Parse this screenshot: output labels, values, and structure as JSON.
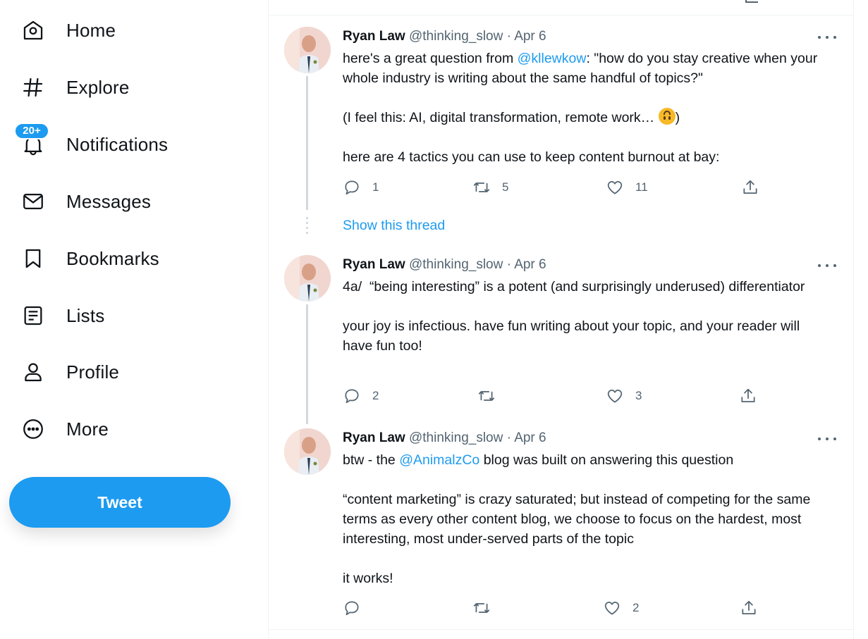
{
  "sidebar": {
    "items": [
      {
        "label": "Home",
        "icon": "home-icon"
      },
      {
        "label": "Explore",
        "icon": "hashtag-icon"
      },
      {
        "label": "Notifications",
        "icon": "bell-icon",
        "badge": "20+"
      },
      {
        "label": "Messages",
        "icon": "envelope-icon"
      },
      {
        "label": "Bookmarks",
        "icon": "bookmark-icon"
      },
      {
        "label": "Lists",
        "icon": "list-icon"
      },
      {
        "label": "Profile",
        "icon": "person-icon"
      },
      {
        "label": "More",
        "icon": "more-circle-icon"
      }
    ],
    "tweet_button": "Tweet"
  },
  "colors": {
    "accent": "#1d9bf0",
    "text": "#0f1419",
    "muted": "#536471",
    "border": "#eff3f4"
  },
  "tweets": [
    {
      "name": "Ryan Law",
      "handle": "@thinking_slow",
      "separator": "·",
      "date": "Apr 6",
      "line1_pre": "here's a great question from ",
      "line1_mention": "@kllewkow",
      "line1_post": ": \"how do you stay creative when your whole industry is writing about the same handful of topics?\"",
      "line2_pre": "(I feel this: AI, digital transformation, remote work… ",
      "line2_emoji": "upside-down-face",
      "line2_post": ")",
      "line3": "here are 4 tactics you can use to keep content burnout at bay:",
      "replies": "1",
      "retweets": "5",
      "likes": "11",
      "show_thread": "Show this thread"
    },
    {
      "name": "Ryan Law",
      "handle": "@thinking_slow",
      "separator": "·",
      "date": "Apr 6",
      "line1": "4a/  “being interesting” is a potent (and surprisingly underused) differentiator",
      "line2": "your joy is infectious. have fun writing about your topic, and your reader will have fun too!",
      "replies": "2",
      "retweets": "",
      "likes": "3"
    },
    {
      "name": "Ryan Law",
      "handle": "@thinking_slow",
      "separator": "·",
      "date": "Apr 6",
      "line1_pre": "btw - the ",
      "line1_mention": "@AnimalzCo",
      "line1_post": " blog was built on answering this question",
      "line2": "“content marketing” is crazy saturated; but instead of competing for the same terms as every other content blog, we choose to focus on the hardest, most interesting, most under-served parts of the topic",
      "line3": "it works!",
      "replies": "",
      "retweets": "",
      "likes": "2"
    }
  ]
}
